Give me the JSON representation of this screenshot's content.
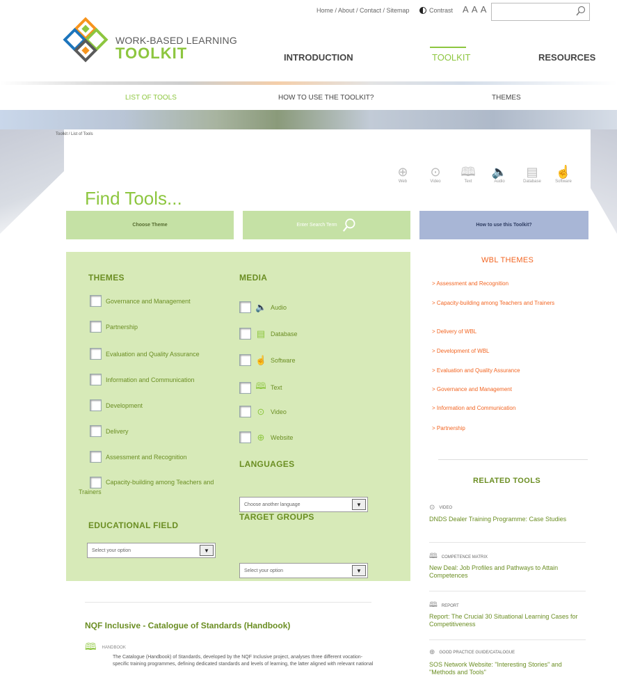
{
  "header": {
    "utility_links": "Home / About / Contact / Sitemap",
    "contrast_label": "Contrast",
    "text_size": "A A A",
    "search_value": "",
    "logo_top": "WORK-BASED LEARNING",
    "logo_main": "TOOLKIT",
    "nav": [
      "INTRODUCTION",
      "TOOLKIT",
      "RESOURCES"
    ],
    "sub_nav": [
      "LIST OF TOOLS",
      "HOW TO USE THE TOOLKIT?",
      "THEMES"
    ]
  },
  "breadcrumb": "Toolkit / List of Tools",
  "find": {
    "title": "Find Tools...",
    "media_filters": [
      {
        "label": "Web",
        "icon": "globe-icon"
      },
      {
        "label": "Video",
        "icon": "play-icon"
      },
      {
        "label": "Text",
        "icon": "book-icon"
      },
      {
        "label": "Audio",
        "icon": "speaker-icon"
      },
      {
        "label": "Database",
        "icon": "database-icon"
      },
      {
        "label": "Software",
        "icon": "pointer-icon"
      }
    ],
    "choose_theme": "Choose Theme",
    "search_placeholder": "Enter Search Term",
    "how_to_use": "How to use this Toolkit?"
  },
  "filters": {
    "themes_title": "THEMES",
    "themes": [
      "Governance and Management",
      "Partnership",
      "Evaluation and Quality Assurance",
      "Information and Communication",
      "Development",
      "Delivery",
      "Assessment and Recognition",
      "Capacity-building among Teachers and Trainers"
    ],
    "media_title": "MEDIA",
    "media": [
      "Audio",
      "Database",
      "Software",
      "Text",
      "Video",
      "Website"
    ],
    "languages_title": "LANGUAGES",
    "languages_select": "Choose another language",
    "educational_title": "EDUCATIONAL FIELD",
    "educational_select": "Select your option",
    "target_title": "TARGET GROUPS",
    "target_select": "Select your option"
  },
  "wbl": {
    "title": "WBL THEMES",
    "links": [
      "> Assessment and Recognition",
      "> Capacity-building among Teachers and Trainers",
      "> Delivery of WBL",
      "> Development of WBL",
      "> Evaluation and Quality Assurance",
      "> Governance and Management",
      "> Information and Communication",
      "> Partnership"
    ]
  },
  "related": {
    "title": "RELATED TOOLS",
    "items": [
      {
        "type": "VIDEO",
        "title": "DNDS Dealer Training Programme: Case Studies"
      },
      {
        "type": "COMPETENCE MATRIX",
        "title": "New Deal: Job Profiles and Pathways to Attain Competences"
      },
      {
        "type": "REPORT",
        "title": "Report: The Crucial 30 Situational Learning Cases for Competitiveness"
      },
      {
        "type": "GOOD PRACTICE GUIDE/CATALOGUE",
        "title": "SOS Network Website: \"Interesting Stories\" and \"Methods and Tools\""
      }
    ]
  },
  "result": {
    "title": "NQF Inclusive - Catalogue of Standards (Handbook)",
    "type": "HANDBOOK",
    "description": "The Catalogue (Handbook) of Standards, developed by the NQF Inclusive project, analyses three different vocation-specific training programmes, defining dedicated standards and levels of learning, the latter aligned with relevant national"
  },
  "colors": {
    "accent_green": "#8dc63f",
    "panel_green": "#d7eab8",
    "orange": "#f26522",
    "blue_button": "#a8b6d6"
  }
}
